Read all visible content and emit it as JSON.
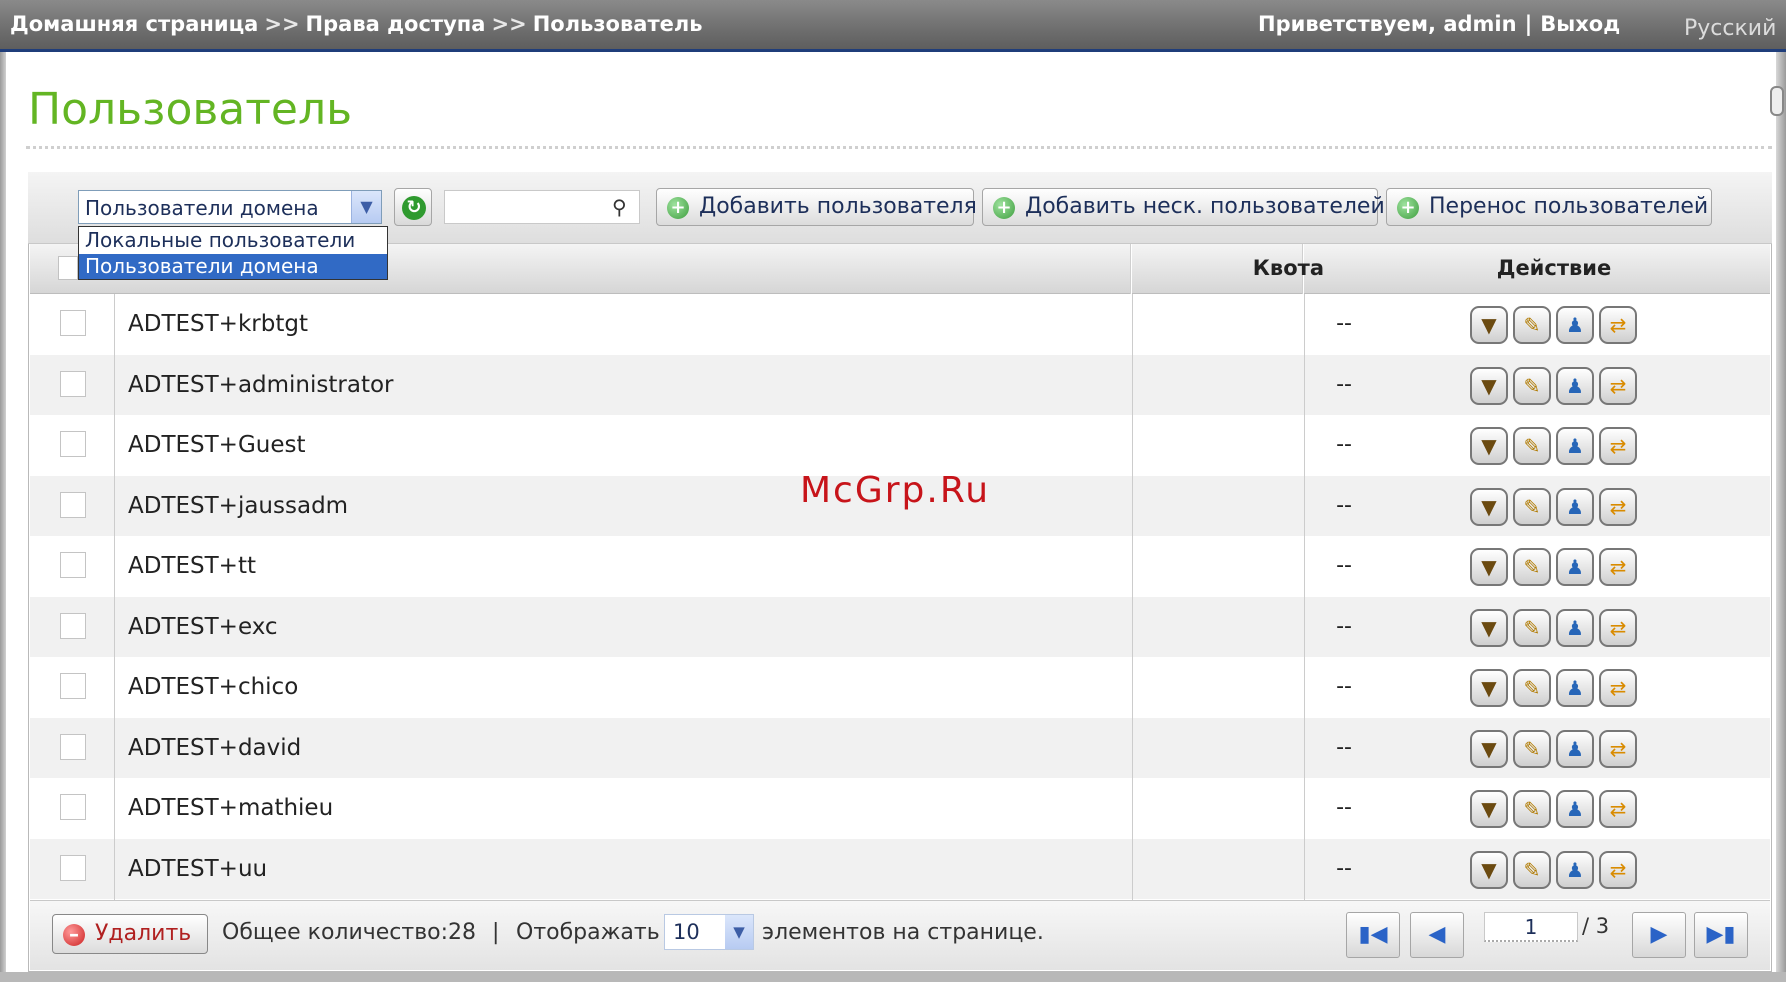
{
  "header": {
    "breadcrumb": [
      "Домашняя страница",
      "Права доступа",
      "Пользователь"
    ],
    "breadcrumb_sep": ">>",
    "greeting": "Приветствуем,",
    "user": "admin",
    "logout": "Выход",
    "language": "Русский"
  },
  "page": {
    "title": "Пользователь"
  },
  "toolbar": {
    "user_type_selected": "Пользователи домена",
    "user_type_options": [
      "Локальные пользователи",
      "Пользователи домена"
    ],
    "search_value": "",
    "add_user": "Добавить пользователя",
    "add_multiple": "Добавить неск. пользователей",
    "transfer_users": "Перенос пользователей"
  },
  "table": {
    "columns": {
      "quota": "Квота",
      "action": "Действие"
    },
    "rows": [
      {
        "name": "ADTEST+krbtgt",
        "quota": "--"
      },
      {
        "name": "ADTEST+administrator",
        "quota": "--"
      },
      {
        "name": "ADTEST+Guest",
        "quota": "--"
      },
      {
        "name": "ADTEST+jaussadm",
        "quota": "--"
      },
      {
        "name": "ADTEST+tt",
        "quota": "--"
      },
      {
        "name": "ADTEST+exc",
        "quota": "--"
      },
      {
        "name": "ADTEST+chico",
        "quota": "--"
      },
      {
        "name": "ADTEST+david",
        "quota": "--"
      },
      {
        "name": "ADTEST+mathieu",
        "quota": "--"
      },
      {
        "name": "ADTEST+uu",
        "quota": "--"
      }
    ],
    "row_action_icons": [
      "key-icon",
      "edit-icon",
      "user-group-icon",
      "transfer-icon"
    ]
  },
  "footer": {
    "delete": "Удалить",
    "total_label": "Общее количество:",
    "total_count": "28",
    "separator": "|",
    "show_label": "Отображать",
    "per_page": "10",
    "per_page_suffix": "элементов на странице.",
    "current_page": "1",
    "total_pages": "/ 3"
  },
  "watermark": "McGrp.Ru",
  "colors": {
    "title_green": "#63b523",
    "header_blue": "#1f3d7a",
    "selection_blue": "#316ac5",
    "watermark_red": "#c7141a"
  }
}
